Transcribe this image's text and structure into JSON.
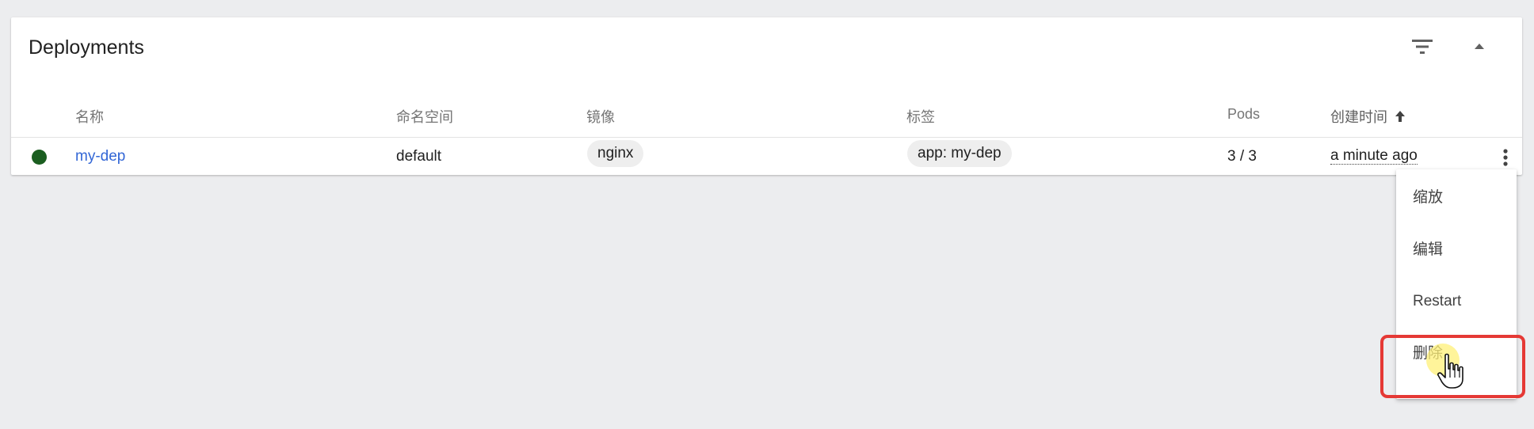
{
  "card": {
    "title": "Deployments",
    "filter_icon": "filter-list-icon",
    "collapse_icon": "expand-less-icon"
  },
  "columns": {
    "name": "名称",
    "namespace": "命名空间",
    "images": "镜像",
    "labels": "标签",
    "pods": "Pods",
    "created": "创建时间",
    "sort_icon": "arrow-upward-icon"
  },
  "rows": [
    {
      "status_color": "#1b5e20",
      "name": "my-dep",
      "namespace": "default",
      "image": "nginx",
      "label": "app: my-dep",
      "pods": "3 / 3",
      "created": "a minute ago",
      "actions_icon": "more-vert-icon"
    }
  ],
  "menu": {
    "items": [
      "缩放",
      "编辑",
      "Restart",
      "删除"
    ]
  },
  "colors": {
    "link": "#3367d6",
    "running": "#1b5e20",
    "highlight": "#e53935"
  }
}
